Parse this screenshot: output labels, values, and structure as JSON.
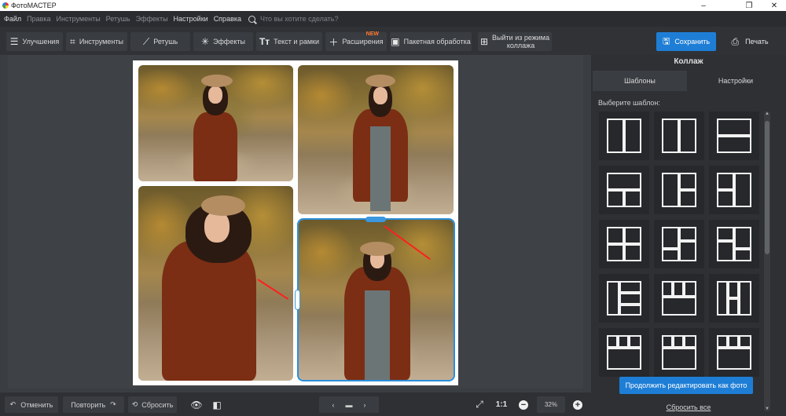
{
  "app": {
    "title": "ФотоМАСТЕР",
    "window_controls": [
      "–",
      "❐",
      "✕"
    ]
  },
  "menu": {
    "items": [
      {
        "label": "Файл",
        "dim": false
      },
      {
        "label": "Правка",
        "dim": true
      },
      {
        "label": "Инструменты",
        "dim": true
      },
      {
        "label": "Ретушь",
        "dim": true
      },
      {
        "label": "Эффекты",
        "dim": true
      },
      {
        "label": "Настройки",
        "dim": false
      },
      {
        "label": "Справка",
        "dim": false
      }
    ],
    "search_placeholder": "Что вы хотите сделать?"
  },
  "toolbar": {
    "improve": "Улучшения",
    "tools": "Инструменты",
    "retouch": "Ретушь",
    "effects": "Эффекты",
    "text": "Текст и рамки",
    "extensions": "Расширения",
    "extensions_badge": "NEW",
    "batch": "Пакетная обработка",
    "exit_collage_line1": "Выйти из режима",
    "exit_collage_line2": "коллажа",
    "save": "Сохранить",
    "print": "Печать"
  },
  "panel": {
    "title": "Коллаж",
    "tab_templates": "Шаблоны",
    "tab_settings": "Настройки",
    "choose_template": "Выберите шаблон:",
    "continue_button": "Продолжить редактировать как фото",
    "reset_all": "Сбросить все",
    "templates": [
      "two-columns",
      "two-columns",
      "two-rows",
      "top-wide-bottom-two",
      "left-one-right-two",
      "left-two-right-one",
      "grid-2x2",
      "grid-2x2-offset",
      "grid-2x2-offset-b",
      "left-three-right-one",
      "top-three-bottom-one",
      "columns-mixed",
      "grid-3x3-partial",
      "grid-3x3-partial",
      "grid-3x3-partial"
    ]
  },
  "bottom": {
    "undo": "Отменить",
    "redo": "Повторить",
    "reset": "Сбросить",
    "ratio": "1:1",
    "zoom": "32%"
  },
  "colors": {
    "accent": "#1e7ed6",
    "selection": "#2a8ed9",
    "annotation_arrow": "#ff1f1f"
  }
}
